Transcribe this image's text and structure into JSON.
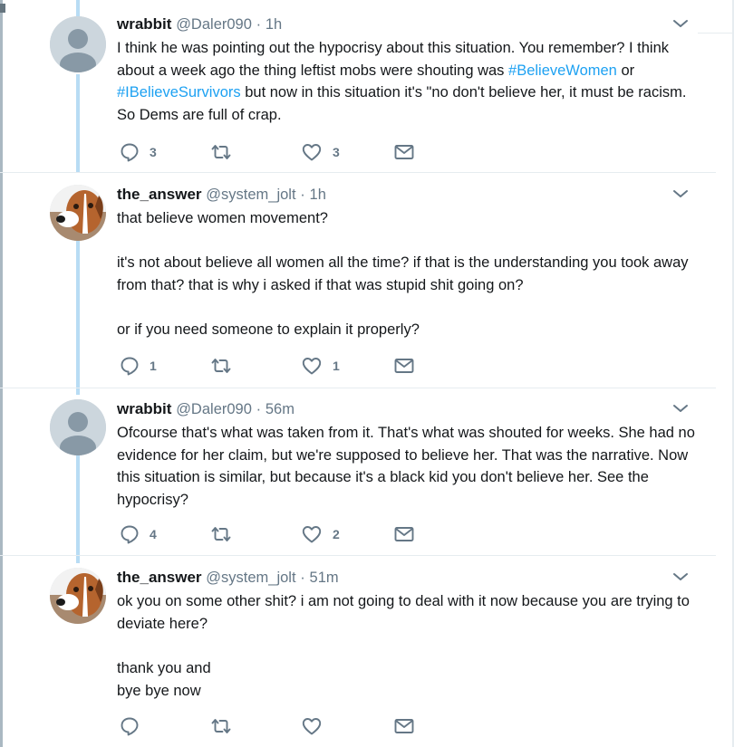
{
  "tweets": [
    {
      "name": "wrabbit",
      "handle": "@Daler090",
      "separator": "·",
      "time": "1h",
      "paragraphs": [
        [
          {
            "text": "I think he was pointing out the hypocrisy about this situation. You remember? I think about a week ago the thing leftist mobs were shouting was "
          },
          {
            "text": "#BelieveWomen",
            "hashtag": true
          },
          {
            "text": "  or "
          },
          {
            "text": "#IBelieveSurvivors",
            "hashtag": true
          },
          {
            "text": " but now in this situation it's \"no don't believe her, it must be racism. So Dems are full of crap."
          }
        ]
      ],
      "reply_count": "3",
      "retweet_count": "",
      "like_count": "3"
    },
    {
      "name": "the_answer",
      "handle": "@system_jolt",
      "separator": "·",
      "time": "1h",
      "paragraphs": [
        [
          {
            "text": "that believe women movement?"
          }
        ],
        [
          {
            "text": "it's not about believe all women all the time? if that is the understanding you took away from that? that is why i asked if that was stupid shit going on?"
          }
        ],
        [
          {
            "text": "or if you need someone to explain it properly?"
          }
        ]
      ],
      "reply_count": "1",
      "retweet_count": "",
      "like_count": "1"
    },
    {
      "name": "wrabbit",
      "handle": "@Daler090",
      "separator": "·",
      "time": "56m",
      "paragraphs": [
        [
          {
            "text": "Ofcourse that's what was taken from it. That's what was shouted for weeks. She had no evidence for her claim, but we're supposed to believe her. That was the narrative. Now this situation is similar, but because it's a black kid you don't believe her. See the hypocrisy?"
          }
        ]
      ],
      "reply_count": "4",
      "retweet_count": "",
      "like_count": "2"
    },
    {
      "name": "the_answer",
      "handle": "@system_jolt",
      "separator": "·",
      "time": "51m",
      "paragraphs": [
        [
          {
            "text": "ok you on some other shit? i am not going to deal with it now because you are trying to deviate here?"
          }
        ],
        [
          {
            "text": "thank you and"
          },
          {
            "text": "\n"
          },
          {
            "text": "bye bye now"
          }
        ]
      ],
      "reply_count": "",
      "retweet_count": "",
      "like_count": ""
    }
  ],
  "icons": {
    "reply": "reply-icon",
    "retweet": "retweet-icon",
    "like": "like-icon",
    "message": "direct-message-icon",
    "caret": "chevron-down-icon",
    "avatar_default": "default-avatar",
    "avatar_dog": "boxer-dog-photo"
  },
  "colors": {
    "hashtag": "#1da1f2",
    "meta_text": "#657786",
    "icon": "#657786",
    "thread_line": "#b8dcf4",
    "divider": "#e6ecf0"
  }
}
